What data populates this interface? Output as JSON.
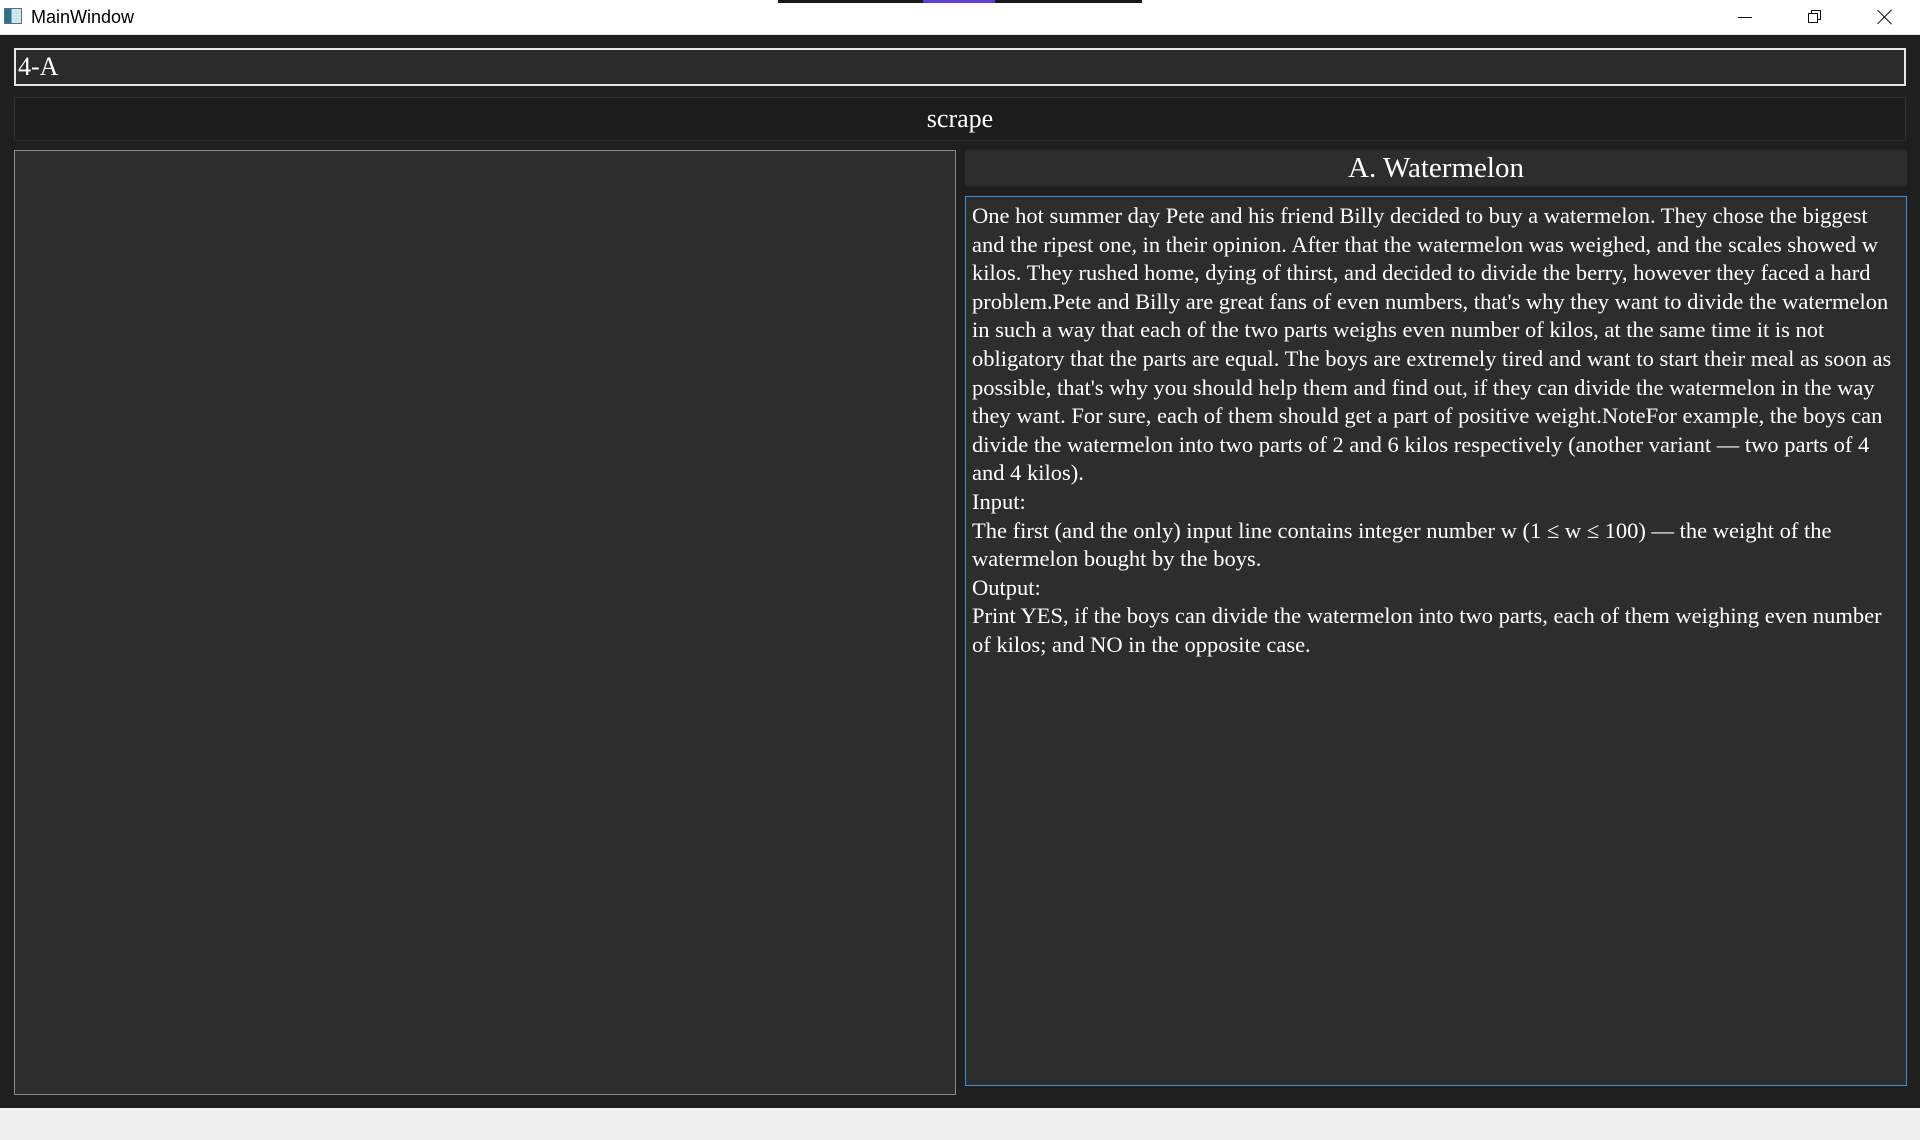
{
  "window": {
    "title": "MainWindow"
  },
  "toolbar": {
    "problem_input_value": "4-A",
    "scrape_label": "scrape"
  },
  "problem": {
    "title": "A. Watermelon",
    "statement": "One hot summer day Pete and his friend Billy decided to buy a watermelon. They chose the biggest and the ripest one, in their opinion. After that the watermelon was weighed, and the scales showed w kilos. They rushed home, dying of thirst, and decided to divide the berry, however they faced a hard problem.Pete and Billy are great fans of even numbers, that's why they want to divide the watermelon in such a way that each of the two parts weighs even number of kilos, at the same time it is not obligatory that the parts are equal. The boys are extremely tired and want to start their meal as soon as possible, that's why you should help them and find out, if they can divide the watermelon in the way they want. For sure, each of them should get a part of positive weight.NoteFor example, the boys can divide the watermelon into two parts of 2 and 6 kilos respectively (another variant — two parts of 4 and 4 kilos).",
    "input_heading": "Input:",
    "input_text": "The first (and the only) input line contains integer number w (1 ≤ w ≤ 100) — the weight of the watermelon bought by the boys.",
    "output_heading": "Output:",
    "output_text": "Print YES, if the boys can divide the watermelon into two parts, each of them weighing even number of kilos; and NO in the opposite case."
  },
  "icons": {
    "app": "window-app-icon",
    "minimize": "minimize-icon",
    "maximize": "restore-icon",
    "close": "close-icon"
  }
}
